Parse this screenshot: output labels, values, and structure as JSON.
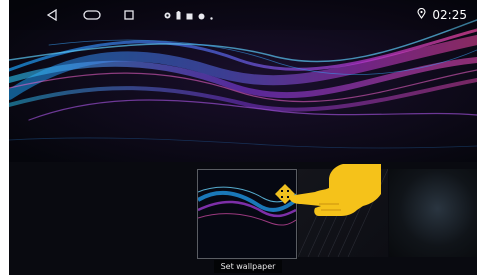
{
  "statusbar": {
    "time": "02:25",
    "nav_icons": [
      "back-icon",
      "home-icon",
      "recents-icon"
    ],
    "notification_icons": [
      "location-icon",
      "battery-icon",
      "image-icon",
      "settings-icon",
      "dot-icon"
    ],
    "location_icon": "location-pin-icon"
  },
  "wallpaper": {
    "colors": {
      "blue": "#1e8df0",
      "pink": "#e13cc8",
      "purple": "#7b2df0",
      "bg": "#070912"
    }
  },
  "picker": {
    "set_wallpaper_label": "Set wallpaper"
  },
  "gesture": {
    "hand_color": "#f5c21a",
    "arrow_color": "#f0c020"
  }
}
